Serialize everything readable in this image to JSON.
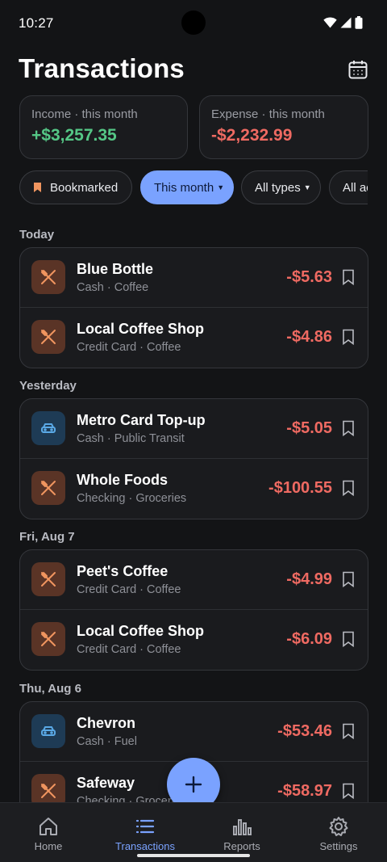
{
  "status_bar": {
    "time": "10:27"
  },
  "header": {
    "title": "Transactions",
    "calendar_icon": "calendar-icon"
  },
  "summary": {
    "income": {
      "label": "Income · this month",
      "value": "+$3,257.35",
      "color": "#55c786"
    },
    "expense": {
      "label": "Expense · this month",
      "value": "-$2,232.99",
      "color": "#ef6a62"
    }
  },
  "filters": {
    "bookmarked": "Bookmarked",
    "period": "This month",
    "types": "All types",
    "accounts": "All ac"
  },
  "sections": [
    {
      "title": "Today",
      "items": [
        {
          "name": "Blue Bottle",
          "account": "Cash · Coffee",
          "amount": "-$5.63",
          "icon": "utensils-icon"
        },
        {
          "name": "Local Coffee Shop",
          "account": "Credit Card · Coffee",
          "amount": "-$4.86",
          "icon": "utensils-icon"
        }
      ]
    },
    {
      "title": "Yesterday",
      "items": [
        {
          "name": "Metro Card Top-up",
          "account": "Cash · Public Transit",
          "amount": "-$5.05",
          "icon": "car-icon"
        },
        {
          "name": "Whole Foods",
          "account": "Checking · Groceries",
          "amount": "-$100.55",
          "icon": "utensils-icon"
        }
      ]
    },
    {
      "title": "Fri, Aug 7",
      "items": [
        {
          "name": "Peet's Coffee",
          "account": "Credit Card · Coffee",
          "amount": "-$4.99",
          "icon": "utensils-icon"
        },
        {
          "name": "Local Coffee Shop",
          "account": "Credit Card · Coffee",
          "amount": "-$6.09",
          "icon": "utensils-icon"
        }
      ]
    },
    {
      "title": "Thu, Aug 6",
      "items": [
        {
          "name": "Chevron",
          "account": "Cash · Fuel",
          "amount": "-$53.46",
          "icon": "car-icon"
        },
        {
          "name": "Safeway",
          "account": "Checking · Groceries",
          "amount": "-$58.97",
          "icon": "utensils-icon"
        }
      ]
    }
  ],
  "nav": {
    "home": "Home",
    "transactions": "Transactions",
    "reports": "Reports",
    "settings": "Settings",
    "active": "transactions"
  },
  "colors": {
    "accent": "#7aa2ff",
    "negative": "#ef6a62",
    "positive": "#55c786",
    "background": "#131416"
  }
}
